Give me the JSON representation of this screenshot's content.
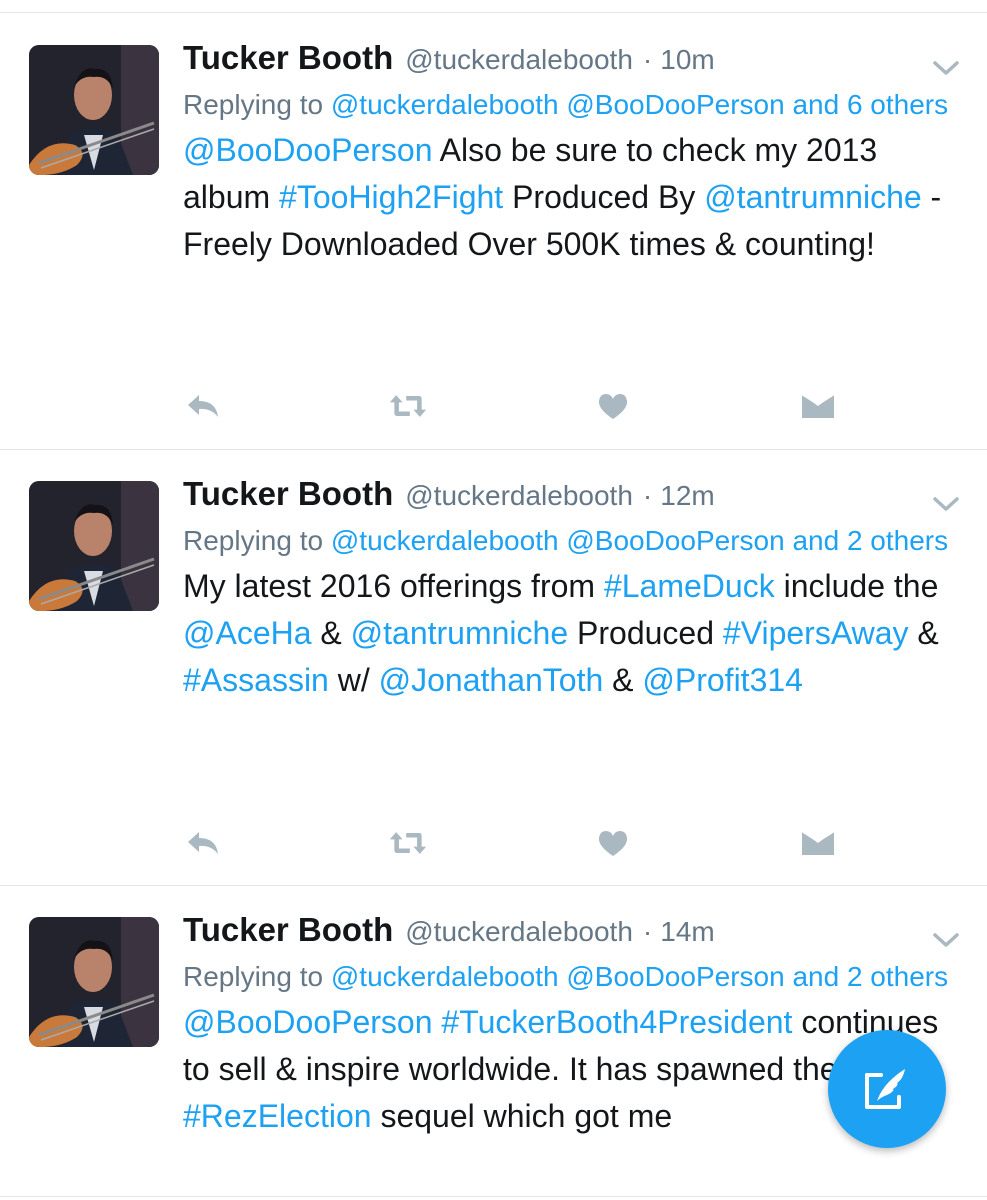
{
  "colors": {
    "link": "#1da1f2",
    "muted": "#657786",
    "text": "#14171a",
    "icon": "#aab8c2",
    "divider": "#e1e8ed",
    "fab": "#1da1f2"
  },
  "tweets": [
    {
      "name": "Tucker Booth",
      "handle": "@tuckerdalebooth",
      "dot": "·",
      "time": "10m",
      "reply_prefix": "Replying to ",
      "reply_user1": "@tuckerdalebooth",
      "reply_user2": "@BooDooPerson",
      "reply_suffix": "and 6 others",
      "body": [
        {
          "t": "@BooDooPerson",
          "link": true
        },
        {
          "t": " Also be sure to check my 2013 album ",
          "link": false
        },
        {
          "t": "#TooHigh2Fight",
          "link": true
        },
        {
          "t": " Produced By ",
          "link": false
        },
        {
          "t": "@tantrumniche",
          "link": true
        },
        {
          "t": " - Freely Downloaded Over 500K times & counting!",
          "link": false
        }
      ]
    },
    {
      "name": "Tucker Booth",
      "handle": "@tuckerdalebooth",
      "dot": "·",
      "time": "12m",
      "reply_prefix": "Replying to ",
      "reply_user1": "@tuckerdalebooth",
      "reply_user2": "@BooDooPerson",
      "reply_suffix": "and 2 others",
      "body": [
        {
          "t": "My latest 2016 offerings from ",
          "link": false
        },
        {
          "t": "#LameDuck",
          "link": true
        },
        {
          "t": " include the ",
          "link": false
        },
        {
          "t": "@AceHa",
          "link": true
        },
        {
          "t": " & ",
          "link": false
        },
        {
          "t": "@tantrumniche",
          "link": true
        },
        {
          "t": " Produced ",
          "link": false
        },
        {
          "t": "#VipersAway",
          "link": true
        },
        {
          "t": " & ",
          "link": false
        },
        {
          "t": "#Assassin",
          "link": true
        },
        {
          "t": " w/ ",
          "link": false
        },
        {
          "t": "@JonathanToth",
          "link": true
        },
        {
          "t": " & ",
          "link": false
        },
        {
          "t": "@Profit314",
          "link": true
        }
      ]
    },
    {
      "name": "Tucker Booth",
      "handle": "@tuckerdalebooth",
      "dot": "·",
      "time": "14m",
      "reply_prefix": "Replying to ",
      "reply_user1": "@tuckerdalebooth",
      "reply_user2": "@BooDooPerson",
      "reply_suffix": "and 2 others",
      "body": [
        {
          "t": "@BooDooPerson",
          "link": true
        },
        {
          "t": " ",
          "link": false
        },
        {
          "t": "#TuckerBooth4President",
          "link": true
        },
        {
          "t": " continues to sell & inspire worldwide. It has spawned the ",
          "link": false
        },
        {
          "t": "#RezElection",
          "link": true
        },
        {
          "t": " sequel which got me",
          "link": false
        }
      ]
    }
  ],
  "icons": {
    "reply": "reply-icon",
    "retweet": "retweet-icon",
    "like": "heart-icon",
    "dm": "envelope-icon",
    "more": "chevron-down-icon",
    "compose": "compose-tweet-icon"
  }
}
